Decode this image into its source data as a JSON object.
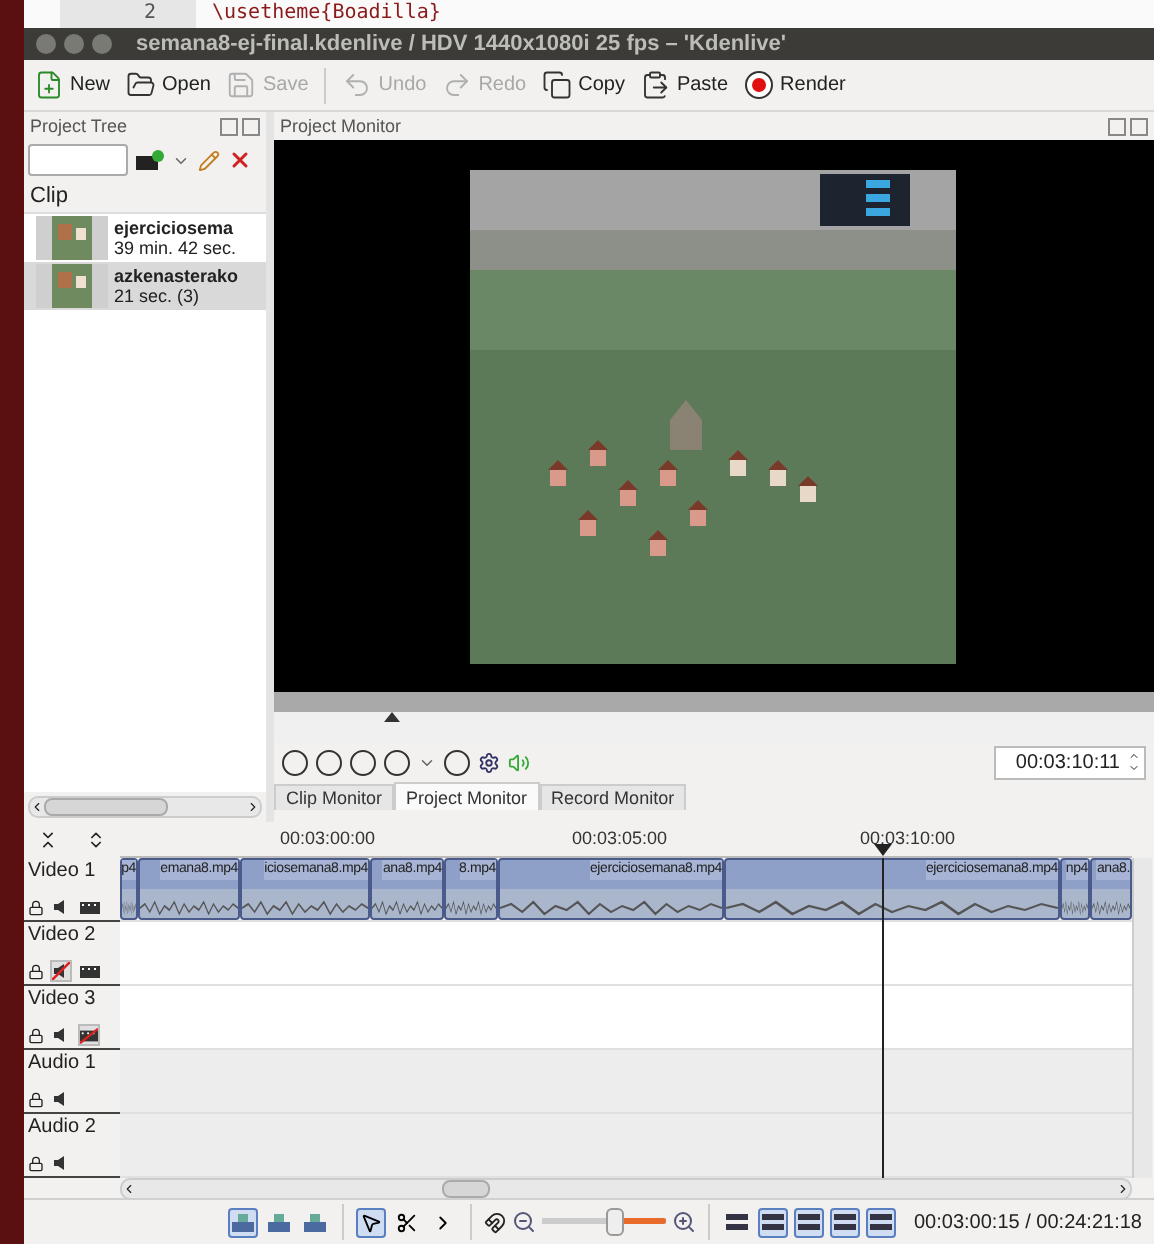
{
  "background_editor": {
    "line_number": "2",
    "code": "\\usetheme{Boadilla}"
  },
  "window": {
    "title": "semana8-ej-final.kdenlive / HDV 1440x1080i 25 fps – 'Kdenlive'"
  },
  "toolbar": [
    {
      "label": "New",
      "disabled": false
    },
    {
      "label": "Open",
      "disabled": false
    },
    {
      "label": "Save",
      "disabled": true
    },
    {
      "label": "Undo",
      "disabled": true
    },
    {
      "label": "Redo",
      "disabled": true
    },
    {
      "label": "Copy",
      "disabled": false
    },
    {
      "label": "Paste",
      "disabled": false
    },
    {
      "label": "Render",
      "disabled": false
    }
  ],
  "project_tree": {
    "title": "Project Tree",
    "column": "Clip",
    "clips": [
      {
        "name": "ejerciciosema",
        "duration": "39 min. 42 sec.",
        "selected": false
      },
      {
        "name": "azkenasterako",
        "duration": "21 sec. (3)",
        "selected": true
      }
    ]
  },
  "monitor": {
    "title": "Project Monitor",
    "timecode": "00:03:10:11",
    "tabs": [
      {
        "label": "Clip Monitor",
        "selected": false
      },
      {
        "label": "Project Monitor",
        "selected": true
      },
      {
        "label": "Record Monitor",
        "selected": false
      }
    ]
  },
  "timeline": {
    "ruler": [
      "00:03:00:00",
      "00:03:05:00",
      "00:03:10:00"
    ],
    "tracks": [
      {
        "kind": "video",
        "name": "Video 1",
        "audio_muted": false,
        "video_hidden": false,
        "clips": [
          "p4",
          "emana8.mp4",
          "iciosemana8.mp4",
          "ana8.mp4",
          "8.mp4",
          "ejerciciosemana8.mp4",
          "ejerciciosemana8.mp4",
          "np4",
          "ana8."
        ]
      },
      {
        "kind": "video",
        "name": "Video 2",
        "audio_muted": true,
        "video_hidden": false
      },
      {
        "kind": "video",
        "name": "Video 3",
        "audio_muted": false,
        "video_hidden": true
      },
      {
        "kind": "audio",
        "name": "Audio 1",
        "audio_muted": false
      },
      {
        "kind": "audio",
        "name": "Audio 2",
        "audio_muted": false
      }
    ]
  },
  "status_bar": {
    "edit_modes": [
      {
        "on": true
      },
      {
        "on": false
      },
      {
        "on": false
      }
    ],
    "tools": [
      {
        "selected": true
      },
      {
        "selected": false
      },
      {
        "selected": false
      }
    ],
    "zoom": {
      "level": 0.58
    },
    "view_toggles": [
      {
        "on": false
      },
      {
        "on": true
      },
      {
        "on": true
      },
      {
        "on": true
      },
      {
        "on": true
      }
    ],
    "timecode": "00:03:00:15 / 00:24:21:18"
  }
}
